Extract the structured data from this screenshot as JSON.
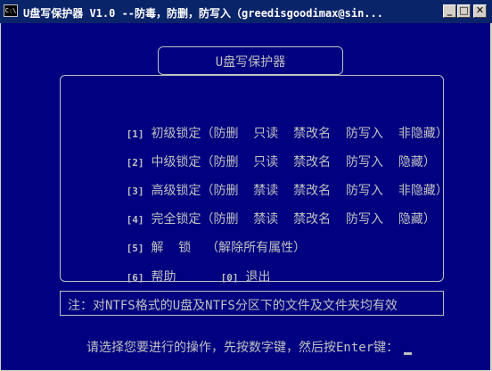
{
  "window": {
    "title": "U盘写保护器 V1.0  --防毒，防删，防写入（greedisgoodimax@sin...",
    "icon_label": "C:\\",
    "minimize_label": "_",
    "maximize_label": "□",
    "close_label": "✕"
  },
  "console": {
    "header_title": "U盘写保护器",
    "menu": [
      {
        "key": "[1]",
        "text": "初级锁定（防删  只读  禁改名  防写入  非隐藏）"
      },
      {
        "key": "[2]",
        "text": "中级锁定（防删  只读  禁改名  防写入  隐藏）"
      },
      {
        "key": "[3]",
        "text": "高级锁定（防删  禁读  禁改名  防写入  非隐藏）"
      },
      {
        "key": "[4]",
        "text": "完全锁定（防删  禁读  禁改名  防写入  隐藏）"
      },
      {
        "key": "[5]",
        "text": "解  锁  （解除所有属性）"
      },
      {
        "key": "[6]",
        "text": "帮助"
      }
    ],
    "exit_item": {
      "key": "[0]",
      "text": "退出"
    },
    "note": "注：对NTFS格式的U盘及NTFS分区下的文件及文件夹均有效",
    "prompt": "请选择您要进行的操作，先按数字键，然后按Enter键："
  },
  "colors": {
    "console_bg": "#000080",
    "console_fg": "#c0c0c0",
    "titlebar_bg": "#0a246a"
  }
}
